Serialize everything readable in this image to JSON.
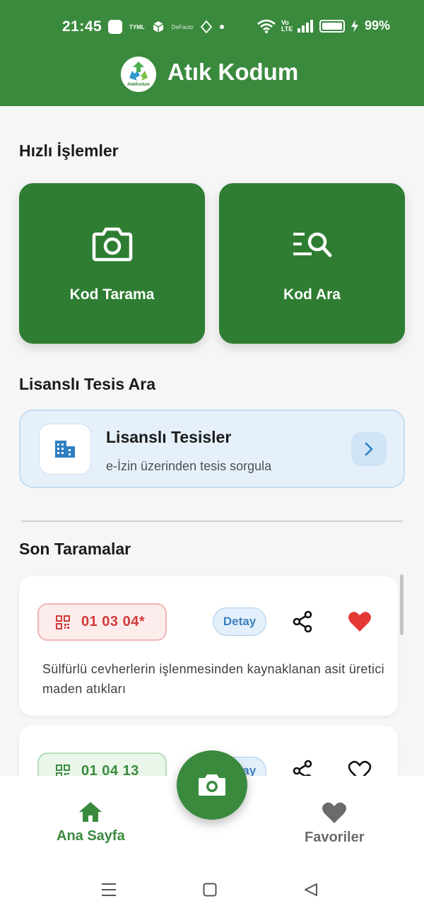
{
  "status_bar": {
    "time": "21:45",
    "small_app_1": "TYML",
    "small_app_2": "DeFacto",
    "network_label": "Vo LTE",
    "battery": "99%"
  },
  "header": {
    "title": "Atık Kodum",
    "logo_text": "AtıkKodum"
  },
  "quick_actions": {
    "title": "Hızlı İşlemler",
    "items": [
      {
        "label": "Kod Tarama",
        "icon": "camera-icon"
      },
      {
        "label": "Kod Ara",
        "icon": "list-search-icon"
      }
    ]
  },
  "facility": {
    "section_title": "Lisanslı Tesis Ara",
    "title": "Lisanslı Tesisler",
    "subtitle": "e-İzin üzerinden tesis sorgula",
    "icon": "building-icon"
  },
  "recent": {
    "title": "Son Taramalar",
    "items": [
      {
        "code": "01 03 04*",
        "detail_label": "Detay",
        "description": "Sülfürlü cevherlerin işlenmesinden kaynaklanan asit üretici maden atıkları",
        "favorite": true,
        "tone": "hazardous",
        "color": "#d23a3a"
      },
      {
        "code": "01 04 13",
        "detail_label": "Detay",
        "description": "",
        "favorite": false,
        "tone": "non-hazardous",
        "color": "#3a8a3e"
      }
    ]
  },
  "bottom_nav": {
    "home_label": "Ana Sayfa",
    "favorites_label": "Favoriler",
    "fab_icon": "camera-icon"
  },
  "colors": {
    "primary": "#3a8a3e",
    "card_green": "#2e7d32",
    "hazard_red": "#d23a3a",
    "info_blue": "#3d7fbf"
  }
}
